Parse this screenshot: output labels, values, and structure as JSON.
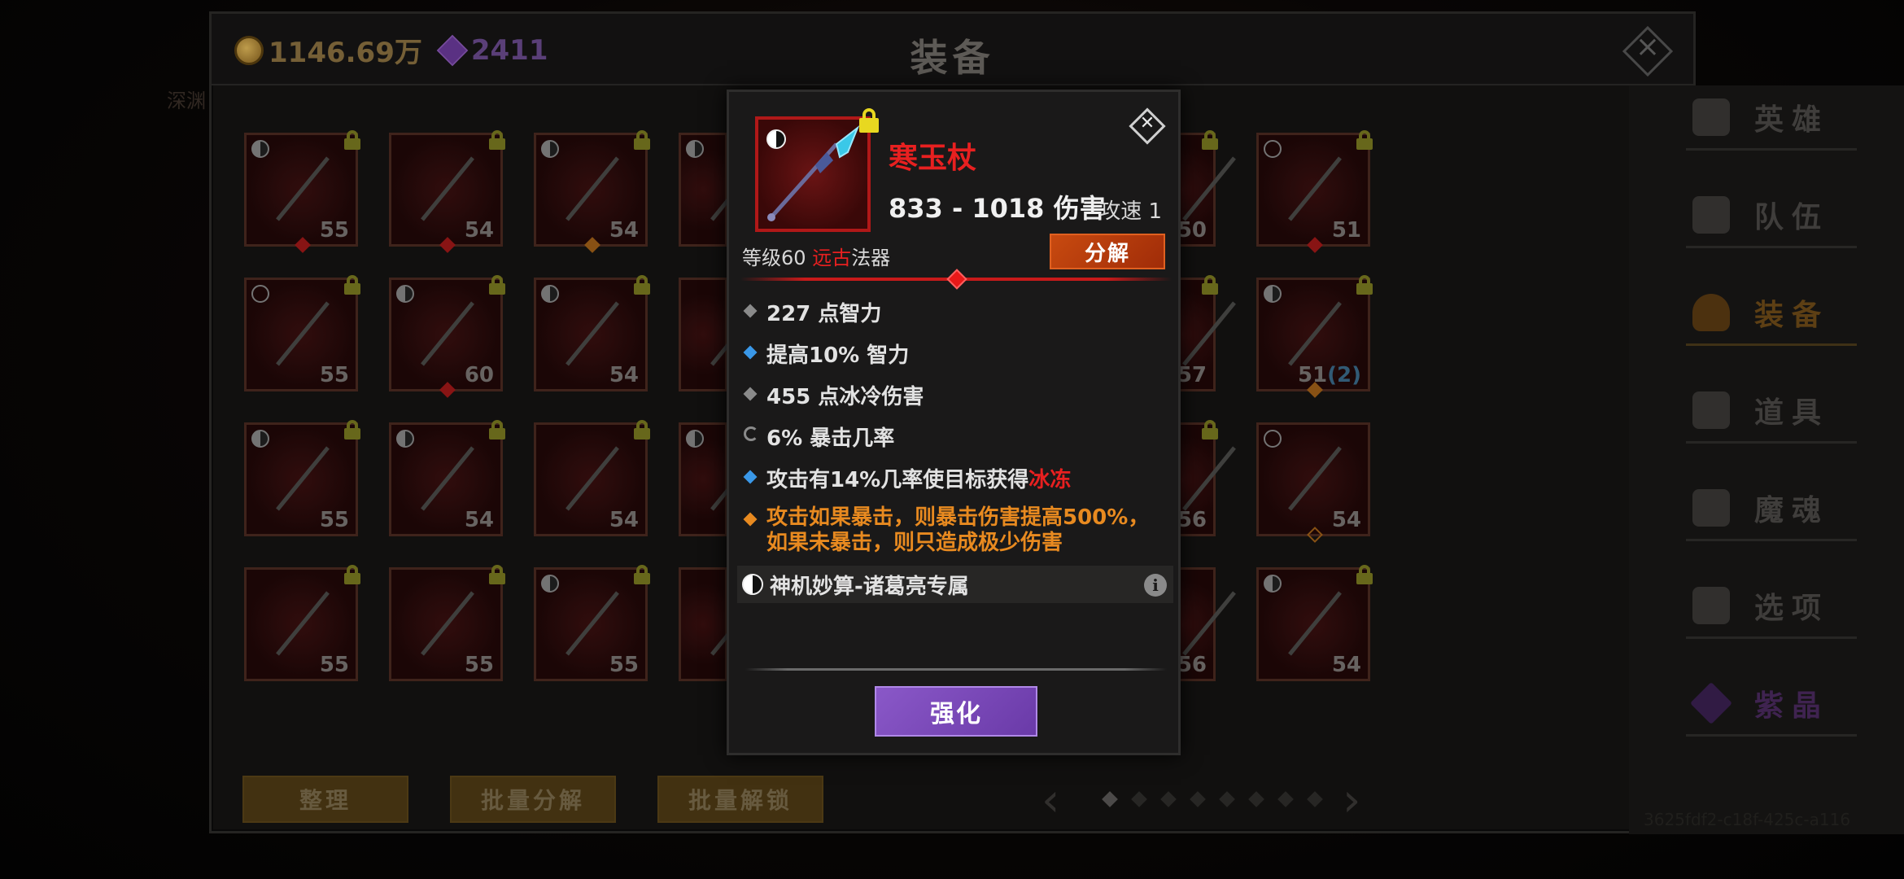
{
  "currency": {
    "gold": "1146.69万",
    "gems": "2411"
  },
  "window": {
    "title": "装备",
    "background_hint": "深渊"
  },
  "sidebar": {
    "items": [
      {
        "label": "英雄",
        "icon": "heroes-icon"
      },
      {
        "label": "队伍",
        "icon": "team-flag-icon"
      },
      {
        "label": "装备",
        "icon": "helmet-icon",
        "active": true
      },
      {
        "label": "道具",
        "icon": "item-bag-icon"
      },
      {
        "label": "魔魂",
        "icon": "soul-flame-icon"
      },
      {
        "label": "选项",
        "icon": "gear-icon"
      },
      {
        "label": "紫晶",
        "icon": "amethyst-icon"
      }
    ],
    "id_text": "3625fdf2-c18f-425c-a116"
  },
  "bottom": {
    "sort": "整理",
    "batch_dismantle": "批量分解",
    "batch_unlock": "批量解锁"
  },
  "grid": {
    "slots": [
      {
        "level": "55",
        "mark": "yy",
        "locked": true,
        "gem": "red"
      },
      {
        "level": "54",
        "mark": "",
        "locked": true,
        "gem": "red"
      },
      {
        "level": "54",
        "mark": "yy",
        "locked": true,
        "gem": "orange"
      },
      {
        "level": "",
        "mark": "yy",
        "locked": false,
        "gem": ""
      },
      {
        "level": "50",
        "mark": "",
        "locked": true,
        "gem": ""
      },
      {
        "level": "51",
        "mark": "ring",
        "locked": true,
        "gem": "red"
      },
      {
        "level": "55",
        "mark": "ring",
        "locked": true,
        "gem": ""
      },
      {
        "level": "60",
        "mark": "yy",
        "locked": true,
        "gem": "red"
      },
      {
        "level": "54",
        "mark": "yy",
        "locked": true,
        "gem": ""
      },
      {
        "level": "",
        "mark": "",
        "locked": false,
        "gem": ""
      },
      {
        "level": "57",
        "mark": "",
        "locked": true,
        "gem": ""
      },
      {
        "level": "51",
        "bonus": "(2)",
        "mark": "yy",
        "locked": true,
        "gem": "orange"
      },
      {
        "level": "55",
        "mark": "yy",
        "locked": true,
        "gem": ""
      },
      {
        "level": "54",
        "mark": "yy",
        "locked": true,
        "gem": ""
      },
      {
        "level": "54",
        "mark": "",
        "locked": true,
        "gem": ""
      },
      {
        "level": "",
        "mark": "yy",
        "locked": false,
        "gem": ""
      },
      {
        "level": "56",
        "mark": "",
        "locked": true,
        "gem": ""
      },
      {
        "level": "54",
        "mark": "ring",
        "locked": false,
        "gem": "orange-hollow"
      },
      {
        "level": "55",
        "mark": "",
        "locked": true,
        "gem": ""
      },
      {
        "level": "55",
        "mark": "",
        "locked": true,
        "gem": ""
      },
      {
        "level": "55",
        "mark": "yy",
        "locked": true,
        "gem": ""
      },
      {
        "level": "",
        "mark": "",
        "locked": false,
        "gem": ""
      },
      {
        "level": "56",
        "mark": "",
        "locked": false,
        "gem": ""
      },
      {
        "level": "54",
        "mark": "yy",
        "locked": true,
        "gem": ""
      }
    ]
  },
  "pager": {
    "pages": 8,
    "current": 1
  },
  "popup": {
    "name": "寒玉杖",
    "damage": "833 - 1018 伤害",
    "attack_speed": "攻速 1",
    "level_prefix": "等级60",
    "rarity": "远古",
    "item_type": "法器",
    "dismantle": "分解",
    "stats": [
      {
        "text": "227 点智力",
        "marker": "grey"
      },
      {
        "text": "提高10% 智力",
        "marker": "blue"
      },
      {
        "text": "455 点冰冷伤害",
        "marker": "grey"
      },
      {
        "text": "6% 暴击几率",
        "marker": "cycle"
      },
      {
        "text": "攻击有14%几率使目标获得",
        "highlight": "冰冻",
        "marker": "blue"
      }
    ],
    "legendary": {
      "line1": "攻击如果暴击，则暴击伤害提高500%，",
      "line2": "如果未暴击，则只造成极少伤害"
    },
    "set_name": "神机妙算-诸葛亮专属",
    "upgrade": "强化"
  },
  "colors": {
    "rarity_red": "#e82020",
    "legendary_orange": "#e88a20",
    "dismantle_orange": "#c84a10",
    "upgrade_purple": "#7a48b8",
    "magic_blue": "#3a98e8"
  }
}
